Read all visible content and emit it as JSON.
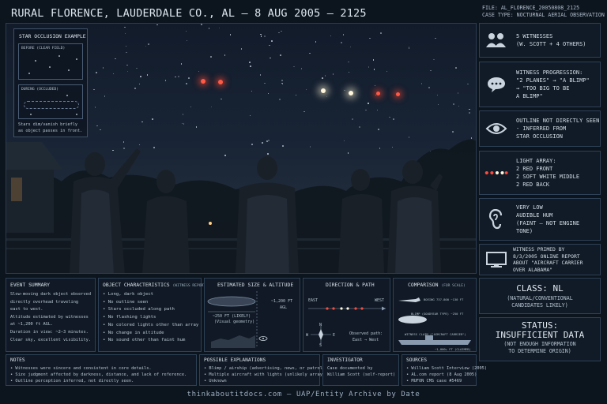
{
  "header": {
    "title": "RURAL FLORENCE, LAUDERDALE CO., AL — 8 AUG 2005 — 2125",
    "file": "FILE: AL_FLORENCE_20050808_2125",
    "case_type": "CASE TYPE: NOCTURNAL AERIAL OBSERVATION"
  },
  "inset": {
    "title": "STAR OCCLUSION EXAMPLE",
    "before_label": "BEFORE (CLEAR FIELD)",
    "during_label": "DURING (OCCLUDED)",
    "caption_1": "Stars dim/vanish briefly",
    "caption_2": "as object passes in front."
  },
  "sidebar": {
    "witnesses": "5 WITNESSES\n(W. SCOTT + 4 OTHERS)",
    "progression": "WITNESS PROGRESSION:\n\"2 PLANES\" → \"A BLIMP\"\n→ \"TOO BIG TO BE\nA BLIMP\"",
    "outline": "OUTLINE NOT DIRECTLY SEEN\n- INFERRED FROM\nSTAR OCCLUSION",
    "lights": "LIGHT ARRAY:\n2 RED FRONT\n2 SOFT WHITE MIDDLE\n2 RED BACK",
    "hum": "VERY LOW\nAUDIBLE HUM\n(FAINT — NOT ENGINE\nTONE)",
    "primed": "WITNESS PRIMED BY\n8/3/2005 ONLINE REPORT\nABOUT \"AIRCRAFT CARRIER\nOVER ALABAMA\""
  },
  "classification": {
    "class_title": "CLASS: NL",
    "class_detail": "(NATURAL/CONVENTIONAL\nCANDIDATES LIKELY)",
    "status_title": "STATUS:\nINSUFFICIENT DATA",
    "status_detail": "(NOT ENOUGH INFORMATION\nTO DETERMINE ORIGIN)"
  },
  "event_summary": {
    "heading": "EVENT SUMMARY",
    "body": "Slow-moving dark object observed\ndirectly overhead traveling\neast to west.\nAltitude estimated by witnesses\nat ~1,200 ft AGL.\nDuration in view: ~2–3 minutes.\nClear sky, excellent visibility."
  },
  "object_characteristics": {
    "heading": "OBJECT CHARACTERISTICS",
    "heading_note": "(WITNESS REPORT)",
    "items": [
      "Long, dark object",
      "No outline seen",
      "Stars occluded along path",
      "No flashing lights",
      "No colored lights other than array",
      "No change in altitude",
      "No sound other than faint hum"
    ]
  },
  "size_altitude": {
    "heading": "ESTIMATED SIZE & ALTITUDE",
    "altitude": "~1,200 FT",
    "agl": "AGL",
    "length": "~250 FT (LIKELY)",
    "length_note": "(Visual geometry)"
  },
  "direction": {
    "heading": "DIRECTION & PATH",
    "east": "EAST",
    "west": "WEST",
    "n": "N",
    "s": "S",
    "e": "E",
    "w": "W",
    "observed_1": "Observed path:",
    "observed_2": "East → West"
  },
  "comparison": {
    "heading": "COMPARISON",
    "heading_note": "(FOR SCALE)",
    "boeing": "BOEING 737-800 ~130 FT",
    "blimp": "BLIMP (GOODYEAR TYPE) ~250 FT",
    "carrier": "WITNESS CLAIM (\"AIRCRAFT CARRIER\")",
    "carrier_size": "~1,000+ FT (CLAIMED)"
  },
  "notes": {
    "heading": "NOTES",
    "items": [
      "• Witnesses were sincere and consistent in core details.",
      "• Size judgment affected by darkness, distance, and lack of reference.",
      "• Outline perception inferred, not directly seen."
    ]
  },
  "explanations": {
    "heading": "POSSIBLE EXPLANATIONS",
    "items": [
      "• Blimp / airship (advertising, news, or patrol)",
      "• Multiple aircraft with lights (unlikely array)",
      "• Unknown"
    ]
  },
  "investigator": {
    "heading": "INVESTIGATOR",
    "line1": "Case documented by",
    "line2": "William Scott (self-report)"
  },
  "sources": {
    "heading": "SOURCES",
    "items": [
      "• William Scott Interview (2005)",
      "• AL.com report (8 Aug 2005)",
      "• MUFON CMS case #5469"
    ]
  },
  "footer": "thinkaboutitdocs.com — UAP/Entity Archive by Date",
  "colors": {
    "red_light": "#ff4a3a",
    "white_light": "#fff6dc",
    "panel_border": "#2e4157"
  }
}
